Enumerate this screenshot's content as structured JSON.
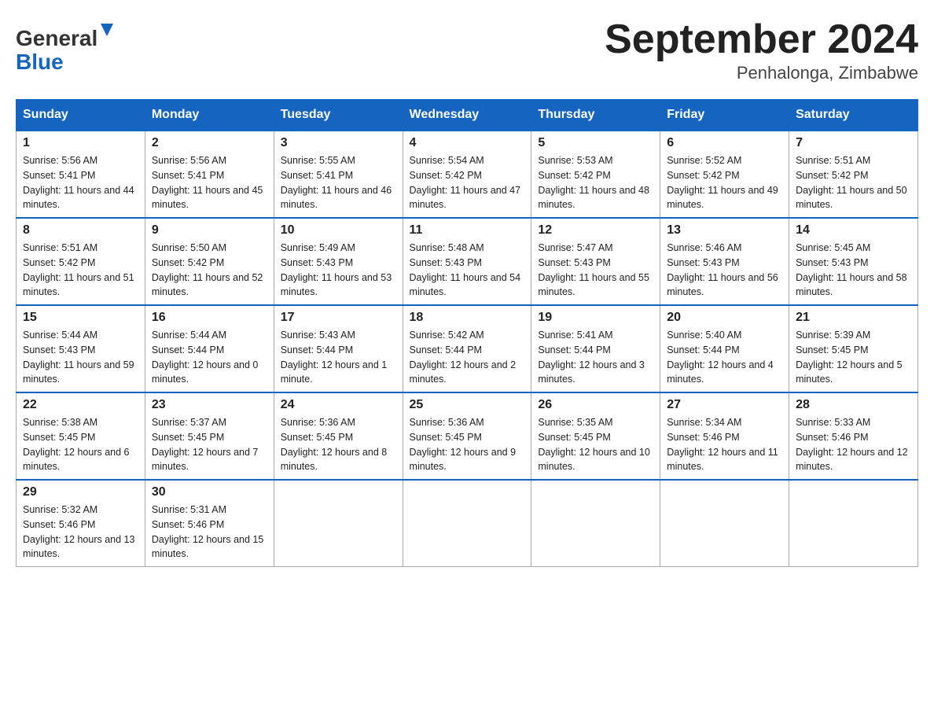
{
  "header": {
    "logo_line1": "General",
    "logo_line2": "Blue",
    "month_year": "September 2024",
    "location": "Penhalonga, Zimbabwe"
  },
  "days_of_week": [
    "Sunday",
    "Monday",
    "Tuesday",
    "Wednesday",
    "Thursday",
    "Friday",
    "Saturday"
  ],
  "weeks": [
    [
      {
        "day": "1",
        "sunrise": "5:56 AM",
        "sunset": "5:41 PM",
        "daylight": "11 hours and 44 minutes."
      },
      {
        "day": "2",
        "sunrise": "5:56 AM",
        "sunset": "5:41 PM",
        "daylight": "11 hours and 45 minutes."
      },
      {
        "day": "3",
        "sunrise": "5:55 AM",
        "sunset": "5:41 PM",
        "daylight": "11 hours and 46 minutes."
      },
      {
        "day": "4",
        "sunrise": "5:54 AM",
        "sunset": "5:42 PM",
        "daylight": "11 hours and 47 minutes."
      },
      {
        "day": "5",
        "sunrise": "5:53 AM",
        "sunset": "5:42 PM",
        "daylight": "11 hours and 48 minutes."
      },
      {
        "day": "6",
        "sunrise": "5:52 AM",
        "sunset": "5:42 PM",
        "daylight": "11 hours and 49 minutes."
      },
      {
        "day": "7",
        "sunrise": "5:51 AM",
        "sunset": "5:42 PM",
        "daylight": "11 hours and 50 minutes."
      }
    ],
    [
      {
        "day": "8",
        "sunrise": "5:51 AM",
        "sunset": "5:42 PM",
        "daylight": "11 hours and 51 minutes."
      },
      {
        "day": "9",
        "sunrise": "5:50 AM",
        "sunset": "5:42 PM",
        "daylight": "11 hours and 52 minutes."
      },
      {
        "day": "10",
        "sunrise": "5:49 AM",
        "sunset": "5:43 PM",
        "daylight": "11 hours and 53 minutes."
      },
      {
        "day": "11",
        "sunrise": "5:48 AM",
        "sunset": "5:43 PM",
        "daylight": "11 hours and 54 minutes."
      },
      {
        "day": "12",
        "sunrise": "5:47 AM",
        "sunset": "5:43 PM",
        "daylight": "11 hours and 55 minutes."
      },
      {
        "day": "13",
        "sunrise": "5:46 AM",
        "sunset": "5:43 PM",
        "daylight": "11 hours and 56 minutes."
      },
      {
        "day": "14",
        "sunrise": "5:45 AM",
        "sunset": "5:43 PM",
        "daylight": "11 hours and 58 minutes."
      }
    ],
    [
      {
        "day": "15",
        "sunrise": "5:44 AM",
        "sunset": "5:43 PM",
        "daylight": "11 hours and 59 minutes."
      },
      {
        "day": "16",
        "sunrise": "5:44 AM",
        "sunset": "5:44 PM",
        "daylight": "12 hours and 0 minutes."
      },
      {
        "day": "17",
        "sunrise": "5:43 AM",
        "sunset": "5:44 PM",
        "daylight": "12 hours and 1 minute."
      },
      {
        "day": "18",
        "sunrise": "5:42 AM",
        "sunset": "5:44 PM",
        "daylight": "12 hours and 2 minutes."
      },
      {
        "day": "19",
        "sunrise": "5:41 AM",
        "sunset": "5:44 PM",
        "daylight": "12 hours and 3 minutes."
      },
      {
        "day": "20",
        "sunrise": "5:40 AM",
        "sunset": "5:44 PM",
        "daylight": "12 hours and 4 minutes."
      },
      {
        "day": "21",
        "sunrise": "5:39 AM",
        "sunset": "5:45 PM",
        "daylight": "12 hours and 5 minutes."
      }
    ],
    [
      {
        "day": "22",
        "sunrise": "5:38 AM",
        "sunset": "5:45 PM",
        "daylight": "12 hours and 6 minutes."
      },
      {
        "day": "23",
        "sunrise": "5:37 AM",
        "sunset": "5:45 PM",
        "daylight": "12 hours and 7 minutes."
      },
      {
        "day": "24",
        "sunrise": "5:36 AM",
        "sunset": "5:45 PM",
        "daylight": "12 hours and 8 minutes."
      },
      {
        "day": "25",
        "sunrise": "5:36 AM",
        "sunset": "5:45 PM",
        "daylight": "12 hours and 9 minutes."
      },
      {
        "day": "26",
        "sunrise": "5:35 AM",
        "sunset": "5:45 PM",
        "daylight": "12 hours and 10 minutes."
      },
      {
        "day": "27",
        "sunrise": "5:34 AM",
        "sunset": "5:46 PM",
        "daylight": "12 hours and 11 minutes."
      },
      {
        "day": "28",
        "sunrise": "5:33 AM",
        "sunset": "5:46 PM",
        "daylight": "12 hours and 12 minutes."
      }
    ],
    [
      {
        "day": "29",
        "sunrise": "5:32 AM",
        "sunset": "5:46 PM",
        "daylight": "12 hours and 13 minutes."
      },
      {
        "day": "30",
        "sunrise": "5:31 AM",
        "sunset": "5:46 PM",
        "daylight": "12 hours and 15 minutes."
      },
      null,
      null,
      null,
      null,
      null
    ]
  ]
}
